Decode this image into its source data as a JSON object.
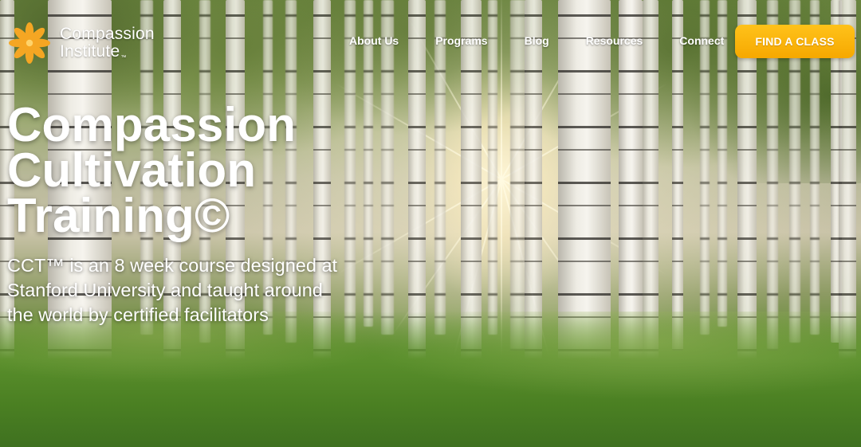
{
  "brand": {
    "line1": "Compassion",
    "line2": "Institute",
    "tm": "™",
    "logo_icon": "sun-flower-icon",
    "logo_color": "#f5a623"
  },
  "nav": {
    "items": [
      "About Us",
      "Programs",
      "Blog",
      "Resources",
      "Connect"
    ]
  },
  "cta": {
    "label": "FIND A CLASS",
    "color": "#f9b20f"
  },
  "hero": {
    "title_lines": [
      "Compassion",
      "Cultivation",
      "Training©"
    ],
    "subtitle_lines": [
      "CCT™ is an 8 week course designed at",
      "Stanford University and taught around",
      "the world by certified facilitators"
    ],
    "background": "birch forest with sunlight"
  }
}
